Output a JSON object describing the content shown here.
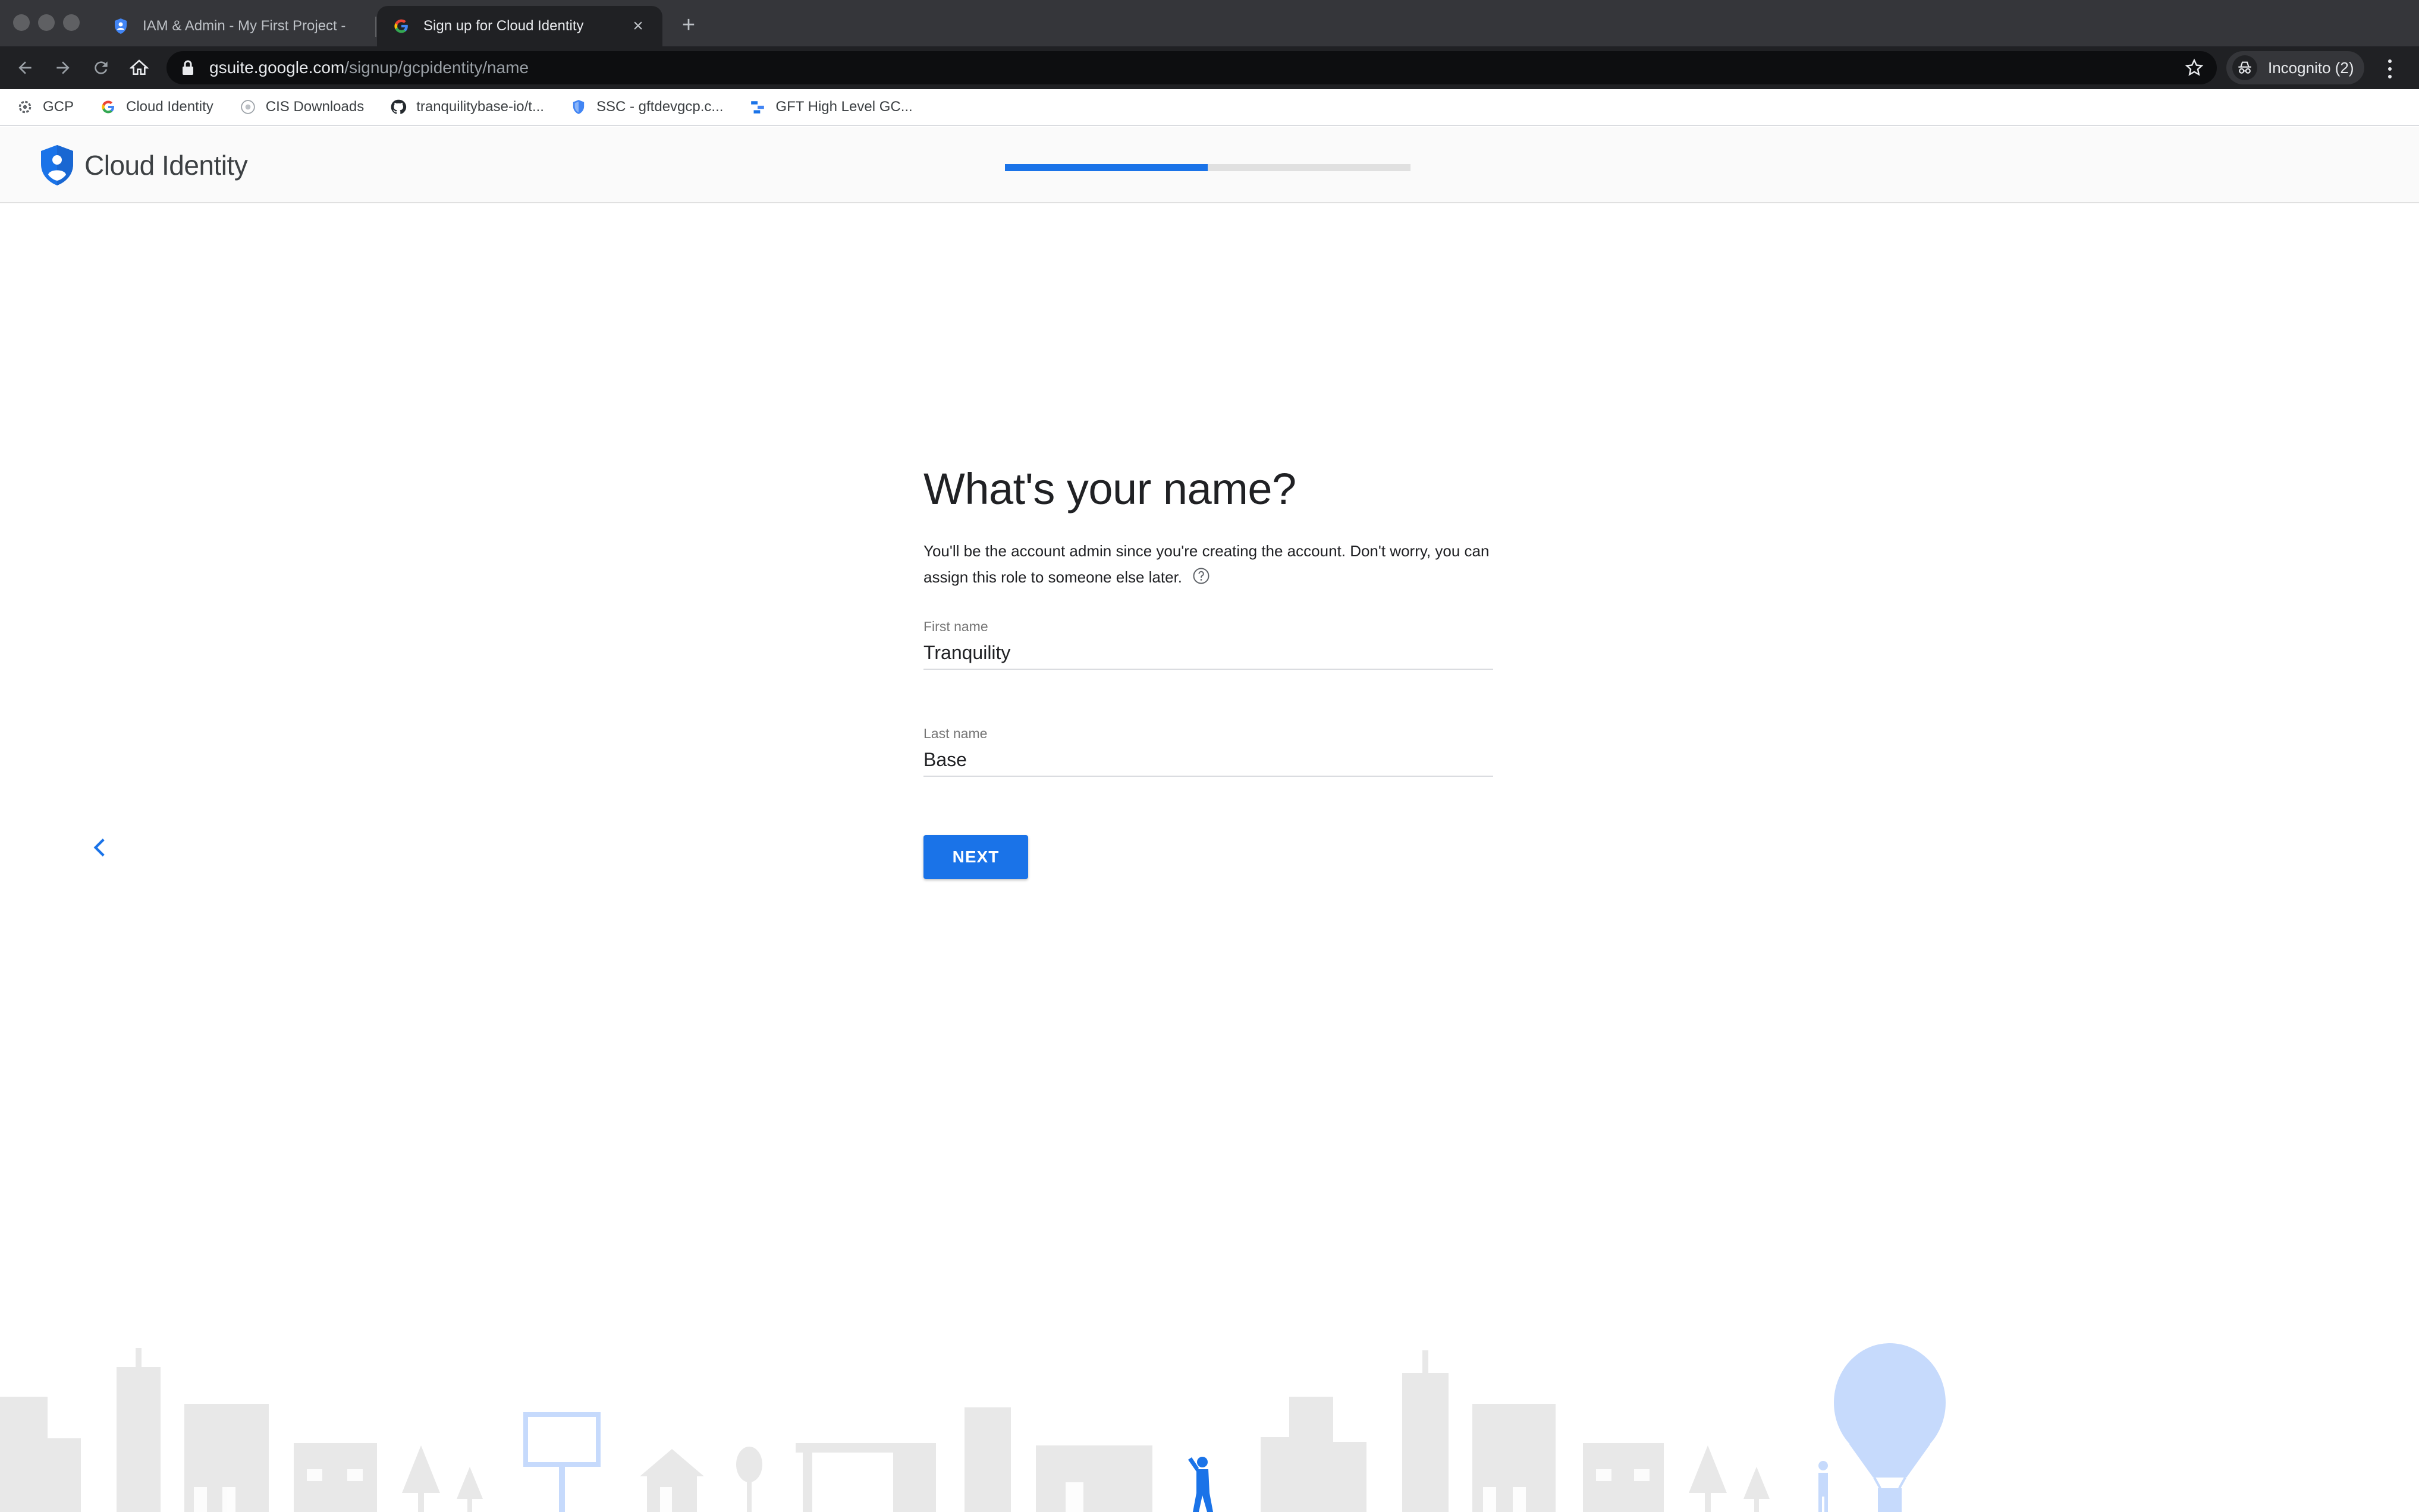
{
  "browser": {
    "tabs": [
      {
        "title": "IAM & Admin - My First Project -",
        "active": false
      },
      {
        "title": "Sign up for Cloud Identity",
        "active": true
      }
    ],
    "url": {
      "host": "gsuite.google.com",
      "path": "/signup/gcpidentity/name"
    },
    "profile_label": "Incognito (2)",
    "bookmarks": [
      {
        "label": "GCP",
        "icon": "gcp-icon"
      },
      {
        "label": "Cloud Identity",
        "icon": "google-icon"
      },
      {
        "label": "CIS Downloads",
        "icon": "cis-icon"
      },
      {
        "label": "tranquilitybase-io/t...",
        "icon": "github-icon"
      },
      {
        "label": "SSC - gftdevgcp.c...",
        "icon": "shield-icon"
      },
      {
        "label": "GFT High Level GC...",
        "icon": "diagram-icon"
      }
    ]
  },
  "header": {
    "brand": "Cloud Identity",
    "progress": 0.5
  },
  "form": {
    "title": "What's your name?",
    "description": "You'll be the account admin since you're creating the account. Don't worry, you can assign this role to someone else later.",
    "first_name": {
      "label": "First name",
      "value": "Tranquility"
    },
    "last_name": {
      "label": "Last name",
      "value": "Base"
    },
    "next_label": "NEXT"
  },
  "colors": {
    "accent": "#1a73e8",
    "city_gray": "#e8e8e8",
    "city_blue": "#c6dafc"
  }
}
